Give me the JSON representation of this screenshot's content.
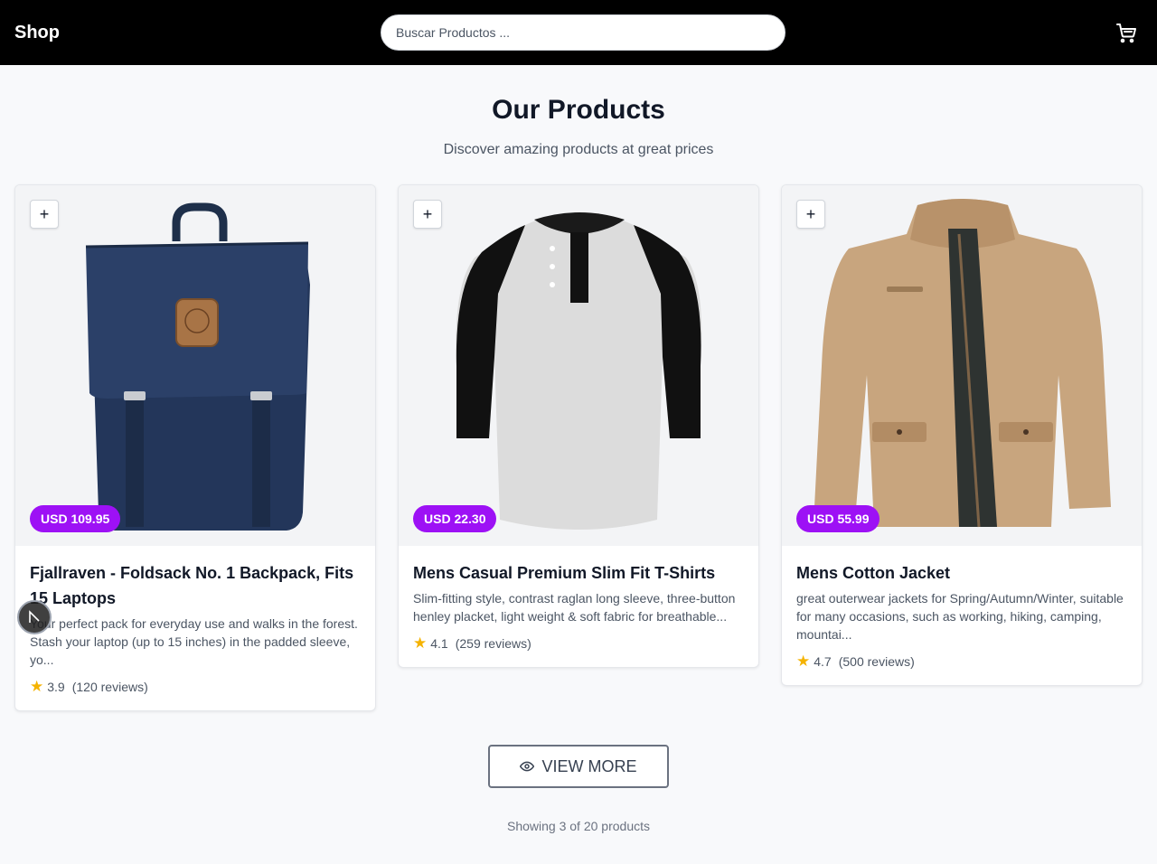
{
  "header": {
    "brand": "Shop",
    "search_placeholder": "Buscar Productos ...",
    "cart_icon": "cart-icon"
  },
  "intro": {
    "title": "Our Products",
    "subtitle": "Discover amazing products at great prices"
  },
  "products": [
    {
      "title": "Fjallraven - Foldsack No. 1 Backpack, Fits 15 Laptops",
      "description": "Your perfect pack for everyday use and walks in the forest. Stash your laptop (up to 15 inches) in the padded sleeve, yo...",
      "price": "USD 109.95",
      "rating": "3.9",
      "reviews": "(120 reviews)",
      "image": "navy backpack"
    },
    {
      "title": "Mens Casual Premium Slim Fit T-Shirts",
      "description": "Slim-fitting style, contrast raglan long sleeve, three-button henley placket, light weight & soft fabric for breathable...",
      "price": "USD 22.30",
      "rating": "4.1",
      "reviews": "(259 reviews)",
      "image": "grey and black raglan henley shirt"
    },
    {
      "title": "Mens Cotton Jacket",
      "description": "great outerwear jackets for Spring/Autumn/Winter, suitable for many occasions, such as working, hiking, camping, mountai...",
      "price": "USD 55.99",
      "rating": "4.7",
      "reviews": "(500 reviews)",
      "image": "khaki cotton jacket"
    }
  ],
  "add_button_label": "+",
  "view_more": {
    "label": "VIEW MORE",
    "icon": "eye-icon"
  },
  "footer": {
    "showing": "Showing 3 of 20 products"
  },
  "colors": {
    "header_bg": "#000000",
    "price_badge": "#9d11f5",
    "star": "#f5b301",
    "page_bg": "#f8f9fb"
  }
}
